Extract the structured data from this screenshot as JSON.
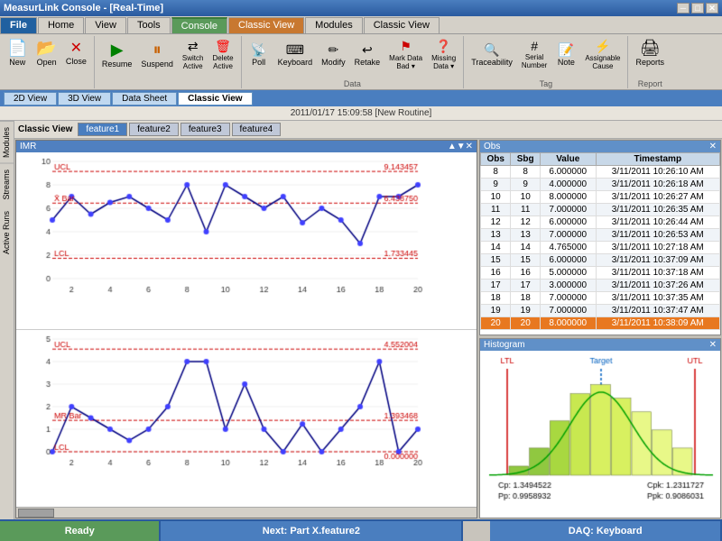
{
  "window": {
    "title": "MeasurLink Console - [Real-Time]",
    "close_btn": "✕",
    "min_btn": "─",
    "max_btn": "□"
  },
  "ribbon_tabs": [
    {
      "label": "File",
      "active": false,
      "style": "blue"
    },
    {
      "label": "Home",
      "active": false,
      "style": "normal"
    },
    {
      "label": "View",
      "active": false,
      "style": "normal"
    },
    {
      "label": "Tools",
      "active": false,
      "style": "normal"
    },
    {
      "label": "Console",
      "active": true,
      "style": "green"
    },
    {
      "label": "Classic View",
      "active": false,
      "style": "orange"
    },
    {
      "label": "Modules",
      "active": false,
      "style": "normal"
    },
    {
      "label": "Classic View",
      "active": false,
      "style": "normal"
    }
  ],
  "toolbar_buttons": [
    {
      "label": "New",
      "icon": "📄"
    },
    {
      "label": "Open",
      "icon": "📂"
    },
    {
      "label": "Close",
      "icon": "✕"
    },
    {
      "label": "Resume",
      "icon": "▶"
    },
    {
      "label": "Suspend",
      "icon": "⏸"
    },
    {
      "label": "Switch Active",
      "icon": "🔄"
    },
    {
      "label": "Delete Active",
      "icon": "🗑"
    },
    {
      "label": "Poll",
      "icon": "📊"
    },
    {
      "label": "Keyboard",
      "icon": "⌨"
    },
    {
      "label": "Modify",
      "icon": "✏"
    },
    {
      "label": "Retake",
      "icon": "↩"
    },
    {
      "label": "Mark Data Bad ▾",
      "icon": "⚑"
    },
    {
      "label": "Missing Data ▾",
      "icon": "?"
    },
    {
      "label": "Traceability",
      "icon": "🔍"
    },
    {
      "label": "Serial Number",
      "icon": "#"
    },
    {
      "label": "Note",
      "icon": "📝"
    },
    {
      "label": "Assignable Cause",
      "icon": "⚡"
    },
    {
      "label": "Reports",
      "icon": "📋"
    }
  ],
  "toolbar_groups": [
    "",
    "",
    "",
    "",
    "Data",
    "",
    "",
    "Tag",
    "",
    "Report"
  ],
  "view_tabs": [
    {
      "label": "2D View",
      "active": false
    },
    {
      "label": "3D View",
      "active": false
    },
    {
      "label": "Data Sheet",
      "active": false
    },
    {
      "label": "Classic View",
      "active": true
    }
  ],
  "timestamp": "2011/01/17 15:09:58 [New Routine]",
  "classic_view": {
    "label": "Classic View",
    "tabs": [
      {
        "label": "feature1",
        "active": true
      },
      {
        "label": "feature2",
        "active": false
      },
      {
        "label": "feature3",
        "active": false
      },
      {
        "label": "feature4",
        "active": false
      }
    ]
  },
  "chart_labels": {
    "xbar_ucl": "UCL",
    "xbar_lcl": "LCL",
    "xbar_bar": "X̄ Bar",
    "mr_ucl": "UCL",
    "mr_lcl": "LCL",
    "mr_bar": "MR Bar",
    "xbar_ucl_val": "9.143457",
    "xbar_xbar_val": "6.438750",
    "xbar_lcl_val": "1.733445",
    "mr_ucl_val": "4.552004",
    "mr_mrbar_val": "1.393468",
    "mr_lcl_val": "0.000000"
  },
  "obs_panel": {
    "title": "Obs",
    "close": "✕",
    "columns": [
      "Obs",
      "Sbg",
      "Value",
      "Timestamp"
    ],
    "rows": [
      {
        "obs": "8",
        "sbg": "8",
        "value": "6.000000",
        "timestamp": "3/11/2011 10:26:10 AM",
        "highlight": ""
      },
      {
        "obs": "9",
        "sbg": "9",
        "value": "4.000000",
        "timestamp": "3/11/2011 10:26:18 AM",
        "highlight": ""
      },
      {
        "obs": "10",
        "sbg": "10",
        "value": "8.000000",
        "timestamp": "3/11/2011 10:26:27 AM",
        "highlight": ""
      },
      {
        "obs": "11",
        "sbg": "11",
        "value": "7.000000",
        "timestamp": "3/11/2011 10:26:35 AM",
        "highlight": ""
      },
      {
        "obs": "12",
        "sbg": "12",
        "value": "6.000000",
        "timestamp": "3/11/2011 10:26:44 AM",
        "highlight": ""
      },
      {
        "obs": "13",
        "sbg": "13",
        "value": "7.000000",
        "timestamp": "3/11/2011 10:26:53 AM",
        "highlight": ""
      },
      {
        "obs": "14",
        "sbg": "14",
        "value": "4.765000",
        "timestamp": "3/11/2011 10:27:18 AM",
        "highlight": ""
      },
      {
        "obs": "15",
        "sbg": "15",
        "value": "6.000000",
        "timestamp": "3/11/2011 10:37:09 AM",
        "highlight": ""
      },
      {
        "obs": "16",
        "sbg": "16",
        "value": "5.000000",
        "timestamp": "3/11/2011 10:37:18 AM",
        "highlight": ""
      },
      {
        "obs": "17",
        "sbg": "17",
        "value": "3.000000",
        "timestamp": "3/11/2011 10:37:26 AM",
        "highlight": ""
      },
      {
        "obs": "18",
        "sbg": "18",
        "value": "7.000000",
        "timestamp": "3/11/2011 10:37:35 AM",
        "highlight": ""
      },
      {
        "obs": "19",
        "sbg": "19",
        "value": "7.000000",
        "timestamp": "3/11/2011 10:37:47 AM",
        "highlight": ""
      },
      {
        "obs": "20",
        "sbg": "20",
        "value": "8.000000",
        "timestamp": "3/11/2011 10:38:09 AM",
        "highlight": "orange"
      }
    ]
  },
  "histogram": {
    "title": "Histogram",
    "ltl": "LTL",
    "target": "Target",
    "utl": "UTL",
    "cp": "Cp: 1.3494522",
    "pp": "Pp: 0.9958932",
    "cpk": "Cpk: 1.2311727",
    "ppk": "Ppk: 0.9086031",
    "bars": [
      0.1,
      0.3,
      0.6,
      0.9,
      1.0,
      0.85,
      0.7,
      0.5,
      0.3
    ],
    "colors": [
      "#90c840",
      "#90c840",
      "#a8d840",
      "#c8e850",
      "#d8f060",
      "#d8f060",
      "#e8f888",
      "#e8f888",
      "#e8f888"
    ]
  },
  "status_bar": {
    "ready": "Ready",
    "next": "Next: Part X.feature2",
    "daq": "DAQ: Keyboard"
  },
  "side_tabs": [
    "Modules",
    "Streams",
    "Active Runs"
  ],
  "x_axis_labels": [
    "2",
    "4",
    "6",
    "8",
    "10",
    "12",
    "14",
    "16",
    "18",
    "20"
  ]
}
